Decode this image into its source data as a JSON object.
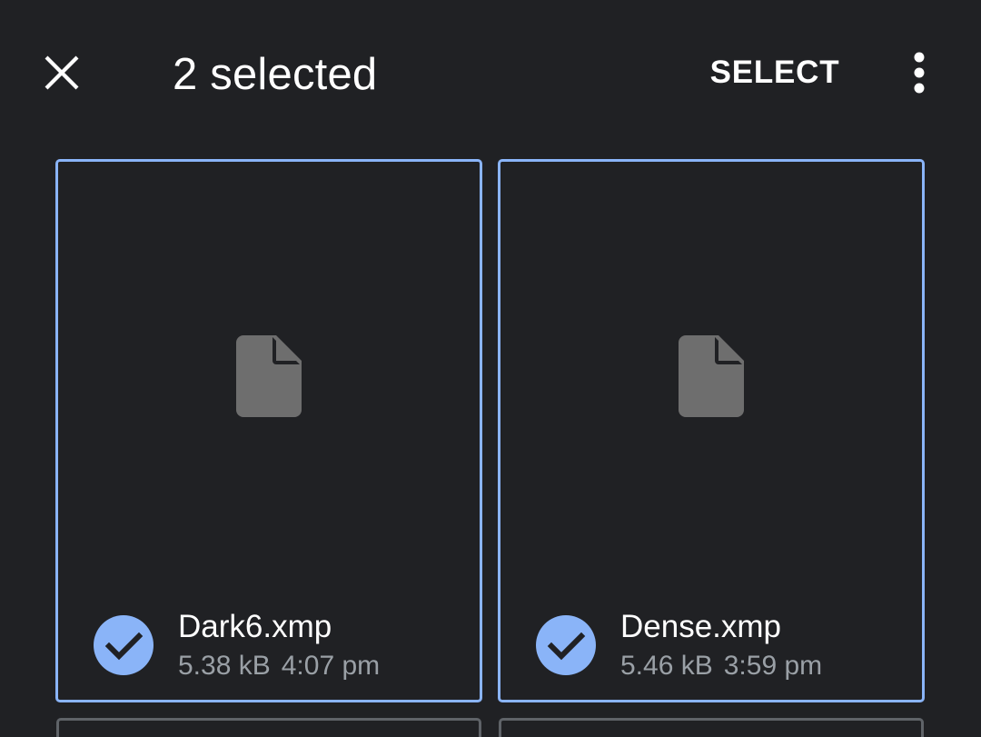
{
  "header": {
    "title": "2 selected",
    "select_label": "SELECT",
    "close_icon": "close-icon",
    "more_icon": "more-vert-icon"
  },
  "files": [
    {
      "name": "Dark6.xmp",
      "size": "5.38 kB",
      "time": "4:07 pm",
      "selected": true,
      "icon": "file-icon"
    },
    {
      "name": "Dense.xmp",
      "size": "5.46 kB",
      "time": "3:59 pm",
      "selected": true,
      "icon": "file-icon"
    }
  ],
  "colors": {
    "background": "#202124",
    "accent": "#8ab4f8",
    "icon_gray": "#6e6e6e",
    "secondary_text": "#9aa0a6"
  }
}
